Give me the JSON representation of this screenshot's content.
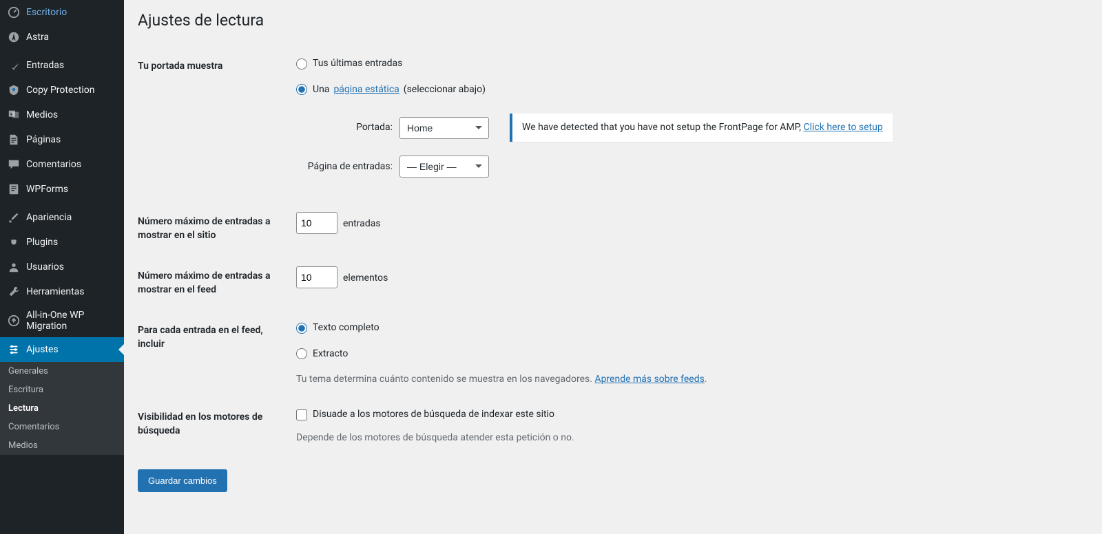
{
  "sidebar": {
    "topItems": [
      {
        "label": "Escritorio",
        "icon": "dashboard"
      },
      {
        "label": "Astra",
        "icon": "astra"
      }
    ],
    "contentItems": [
      {
        "label": "Entradas",
        "icon": "pin"
      },
      {
        "label": "Copy Protection",
        "icon": "shield"
      },
      {
        "label": "Medios",
        "icon": "media"
      },
      {
        "label": "Páginas",
        "icon": "page"
      },
      {
        "label": "Comentarios",
        "icon": "comment"
      },
      {
        "label": "WPForms",
        "icon": "form"
      }
    ],
    "adminItems": [
      {
        "label": "Apariencia",
        "icon": "brush"
      },
      {
        "label": "Plugins",
        "icon": "plug"
      },
      {
        "label": "Usuarios",
        "icon": "user"
      },
      {
        "label": "Herramientas",
        "icon": "wrench"
      },
      {
        "label": "All-in-One WP Migration",
        "icon": "migration"
      },
      {
        "label": "Ajustes",
        "icon": "settings",
        "active": true
      }
    ],
    "submenu": [
      {
        "label": "Generales"
      },
      {
        "label": "Escritura"
      },
      {
        "label": "Lectura",
        "current": true
      },
      {
        "label": "Comentarios"
      },
      {
        "label": "Medios"
      }
    ]
  },
  "page": {
    "title": "Ajustes de lectura",
    "frontpage": {
      "label": "Tu portada muestra",
      "option1": "Tus últimas entradas",
      "option2_prefix": "Una ",
      "option2_link": "página estática",
      "option2_suffix": " (seleccionar abajo)",
      "homepageLabel": "Portada:",
      "homepageValue": "Home",
      "postsPageLabel": "Página de entradas:",
      "postsPageValue": "— Elegir —",
      "notice_text": "We have detected that you have not setup the FrontPage for AMP, ",
      "notice_link": "Click here to setup"
    },
    "postsPerPage": {
      "label": "Número máximo de entradas a mostrar en el sitio",
      "value": "10",
      "suffix": "entradas"
    },
    "postsPerRSS": {
      "label": "Número máximo de entradas a mostrar en el feed",
      "value": "10",
      "suffix": "elementos"
    },
    "feedInclude": {
      "label": "Para cada entrada en el feed, incluir",
      "option1": "Texto completo",
      "option2": "Extracto",
      "desc_text": "Tu tema determina cuánto contenido se muestra en los navegadores. ",
      "desc_link": "Aprende más sobre feeds",
      "desc_suffix": "."
    },
    "searchVis": {
      "label": "Visibilidad en los motores de búsqueda",
      "checkbox": "Disuade a los motores de búsqueda de indexar este sitio",
      "desc": "Depende de los motores de búsqueda atender esta petición o no."
    },
    "save": "Guardar cambios"
  }
}
